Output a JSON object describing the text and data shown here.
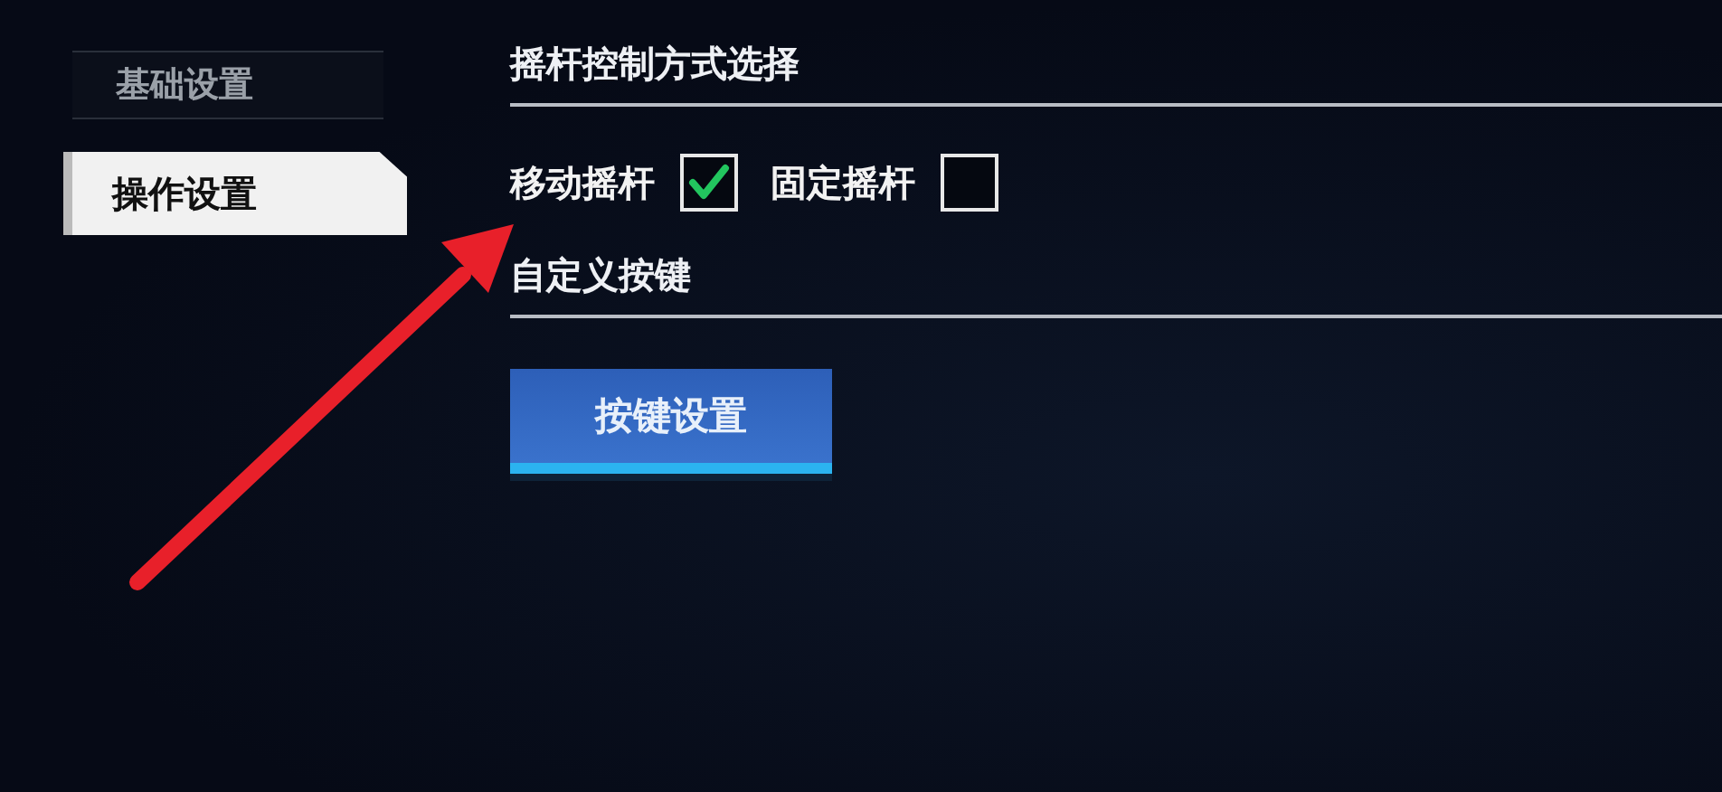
{
  "sidebar": {
    "items": [
      {
        "label": "基础设置",
        "selected": false
      },
      {
        "label": "操作设置",
        "selected": true
      }
    ]
  },
  "sections": [
    {
      "title": "摇杆控制方式选择",
      "options": [
        {
          "kind": "checkbox",
          "label": "移动摇杆",
          "checked": true
        },
        {
          "kind": "checkbox",
          "label": "固定摇杆",
          "checked": false
        }
      ]
    },
    {
      "title": "自定义按键",
      "buttons": [
        "按键设置"
      ]
    }
  ]
}
